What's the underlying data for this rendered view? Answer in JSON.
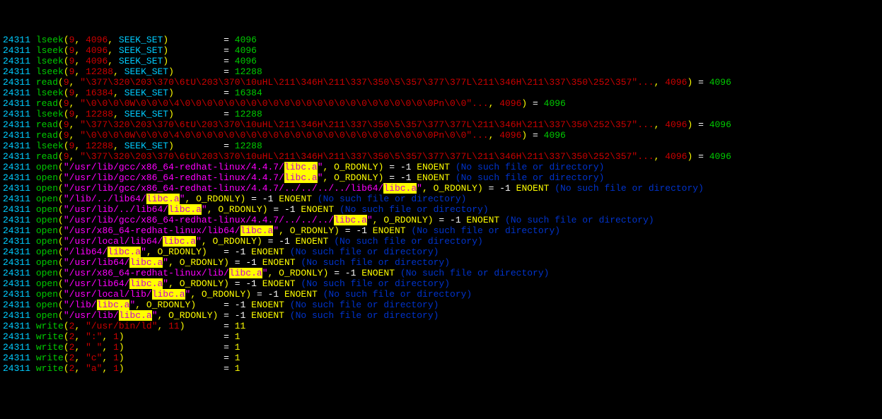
{
  "pid": "24311",
  "highlight": "libc.a",
  "enoent_msg": "(No such file or directory)",
  "lines": [
    {
      "type": "lseek",
      "fd": "9",
      "arg": "4096",
      "whence": "SEEK_SET",
      "ret": "4096"
    },
    {
      "type": "lseek",
      "fd": "9",
      "arg": "4096",
      "whence": "SEEK_SET",
      "ret": "4096"
    },
    {
      "type": "lseek",
      "fd": "9",
      "arg": "4096",
      "whence": "SEEK_SET",
      "ret": "4096"
    },
    {
      "type": "lseek",
      "fd": "9",
      "arg": "12288",
      "whence": "SEEK_SET",
      "ret": "12288"
    },
    {
      "type": "read",
      "fd": "9",
      "buf": "\"\\377\\320\\203\\370\\6tU\\203\\370\\10uHL\\211\\346H\\211\\337\\350\\5\\357\\377\\377L\\211\\346H\\211\\337\\350\\252\\357\"...",
      "len": "4096",
      "ret": "4096"
    },
    {
      "type": "lseek",
      "fd": "9",
      "arg": "16384",
      "whence": "SEEK_SET",
      "ret": "16384"
    },
    {
      "type": "read",
      "fd": "9",
      "buf": "\"\\0\\0\\0\\0W\\0\\0\\0\\4\\0\\0\\0\\0\\0\\0\\0\\0\\0\\0\\0\\0\\0\\0\\0\\0\\0\\0\\0\\0\\0\\0\\0Pn\\0\\0\"...",
      "len": "4096",
      "ret": "4096"
    },
    {
      "type": "lseek",
      "fd": "9",
      "arg": "12288",
      "whence": "SEEK_SET",
      "ret": "12288"
    },
    {
      "type": "read",
      "fd": "9",
      "buf": "\"\\377\\320\\203\\370\\6tU\\203\\370\\10uHL\\211\\346H\\211\\337\\350\\5\\357\\377\\377L\\211\\346H\\211\\337\\350\\252\\357\"...",
      "len": "4096",
      "ret": "4096"
    },
    {
      "type": "read",
      "fd": "9",
      "buf": "\"\\0\\0\\0\\0W\\0\\0\\0\\4\\0\\0\\0\\0\\0\\0\\0\\0\\0\\0\\0\\0\\0\\0\\0\\0\\0\\0\\0\\0\\0\\0\\0Pn\\0\\0\"...",
      "len": "4096",
      "ret": "4096"
    },
    {
      "type": "lseek",
      "fd": "9",
      "arg": "12288",
      "whence": "SEEK_SET",
      "ret": "12288"
    },
    {
      "type": "read",
      "fd": "9",
      "buf": "\"\\377\\320\\203\\370\\6tU\\203\\370\\10uHL\\211\\346H\\211\\337\\350\\5\\357\\377\\377L\\211\\346H\\211\\337\\350\\252\\357\"...",
      "len": "4096",
      "ret": "4096"
    },
    {
      "type": "open",
      "path": "/usr/lib/gcc/x86_64-redhat-linux/4.4.7/",
      "hl": true,
      "flag": "O_RDONLY",
      "eqcol": 60
    },
    {
      "type": "open",
      "path": "/usr/lib/gcc/x86_64-redhat-linux/4.4.7/",
      "hl": true,
      "flag": "O_RDONLY",
      "eqcol": 60
    },
    {
      "type": "open",
      "path": "/usr/lib/gcc/x86_64-redhat-linux/4.4.7/../../../../lib64/",
      "hl": true,
      "flag": "O_RDONLY",
      "eqcol": 78
    },
    {
      "type": "open",
      "path": "/lib/../lib64/",
      "hl": true,
      "flag": "O_RDONLY",
      "eqcol": 35
    },
    {
      "type": "open",
      "path": "/usr/lib/../lib64/",
      "hl": true,
      "flag": "O_RDONLY",
      "eqcol": 39
    },
    {
      "type": "open",
      "path": "/usr/lib/gcc/x86_64-redhat-linux/4.4.7/../../../",
      "hl": true,
      "flag": "O_RDONLY",
      "eqcol": 69
    },
    {
      "type": "open",
      "path": "/usr/x86_64-redhat-linux/lib64/",
      "hl": true,
      "flag": "O_RDONLY",
      "eqcol": 52
    },
    {
      "type": "open",
      "path": "/usr/local/lib64/",
      "hl": true,
      "flag": "O_RDONLY",
      "eqcol": 38
    },
    {
      "type": "open",
      "path": "/lib64/",
      "hl": true,
      "flag": "O_RDONLY",
      "eqcol": 34
    },
    {
      "type": "open",
      "path": "/usr/lib64/",
      "hl": true,
      "flag": "O_RDONLY",
      "eqcol": 34
    },
    {
      "type": "open",
      "path": "/usr/x86_64-redhat-linux/lib/",
      "hl": true,
      "flag": "O_RDONLY",
      "eqcol": 50
    },
    {
      "type": "open",
      "path": "/usr/lib64/",
      "hl": true,
      "flag": "O_RDONLY",
      "eqcol": 34
    },
    {
      "type": "open",
      "path": "/usr/local/lib/",
      "hl": true,
      "flag": "O_RDONLY",
      "eqcol": 36
    },
    {
      "type": "open",
      "path": "/lib/",
      "hl": true,
      "flag": "O_RDONLY",
      "eqcol": 34
    },
    {
      "type": "open",
      "path": "/usr/lib/",
      "hl": true,
      "flag": "O_RDONLY",
      "eqcol": 34
    },
    {
      "type": "write",
      "fd": "2",
      "str": "\"/usr/bin/ld\"",
      "len": "11",
      "ret": "11"
    },
    {
      "type": "write",
      "fd": "2",
      "str": "\":\"",
      "len": "1",
      "ret": "1"
    },
    {
      "type": "write",
      "fd": "2",
      "str": "\" \"",
      "len": "1",
      "ret": "1"
    },
    {
      "type": "write",
      "fd": "2",
      "str": "\"c\"",
      "len": "1",
      "ret": "1"
    },
    {
      "type": "write",
      "fd": "2",
      "str": "\"a\"",
      "len": "1",
      "ret": "1"
    }
  ]
}
